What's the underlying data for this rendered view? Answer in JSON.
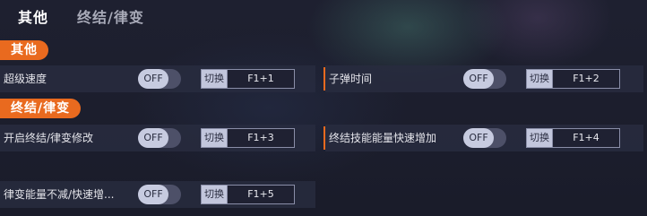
{
  "tabs": {
    "active": "其他",
    "inactive": "终结/律变"
  },
  "sections": {
    "other": {
      "badge": "其他",
      "rows": [
        {
          "label": "超级速度",
          "toggle": "OFF",
          "switch_label": "切换",
          "hotkey": "F1+1"
        },
        {
          "label": "子弹时间",
          "toggle": "OFF",
          "switch_label": "切换",
          "hotkey": "F1+2"
        }
      ]
    },
    "finisher": {
      "badge": "终结/律变",
      "rows": [
        {
          "label": "开启终结/律变修改",
          "toggle": "OFF",
          "switch_label": "切换",
          "hotkey": "F1+3"
        },
        {
          "label": "终结技能能量快速增加",
          "toggle": "OFF",
          "switch_label": "切换",
          "hotkey": "F1+4"
        },
        {
          "label": "律变能量不减/快速增...",
          "toggle": "OFF",
          "switch_label": "切换",
          "hotkey": "F1+5"
        }
      ]
    }
  },
  "colors": {
    "accent": "#e96a1f",
    "row_bg": "#282c40",
    "toggle_knob": "#c7cbe0"
  }
}
